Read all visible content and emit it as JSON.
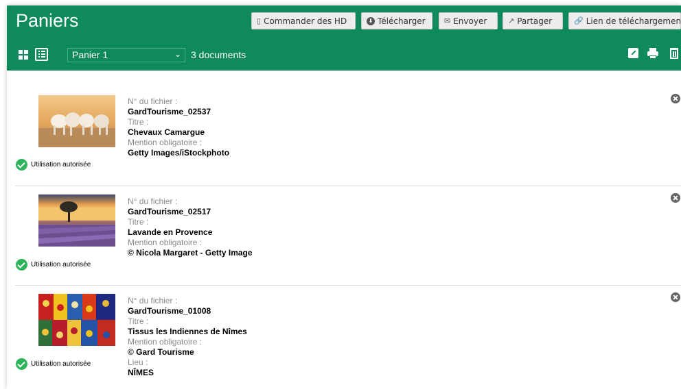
{
  "page": {
    "title": "Paniers"
  },
  "toolbar": {
    "buttons": [
      {
        "label": "Commander des HD",
        "icon": "clipboard-icon"
      },
      {
        "label": "Télécharger",
        "icon": "download-icon"
      },
      {
        "label": "Envoyer",
        "icon": "envelope-icon"
      },
      {
        "label": "Partager",
        "icon": "share-icon"
      },
      {
        "label": "Lien de téléchargement",
        "icon": "link-icon"
      }
    ]
  },
  "subbar": {
    "selected_basket": "Panier 1",
    "document_count": "3 documents"
  },
  "labels": {
    "file_number": "N° du fichier :",
    "title": "Titre :",
    "mandatory_credit": "Mention obligatoire :",
    "place": "Lieu :"
  },
  "items": [
    {
      "status": "Utilisation autorisée",
      "file_number": "GardTourisme_02537",
      "title": "Chevaux Camargue",
      "credit": "Getty Images/iStockphoto"
    },
    {
      "status": "Utilisation autorisée",
      "file_number": "GardTourisme_02517",
      "title": "Lavande en Provence",
      "credit": "© Nicola Margaret - Getty Image"
    },
    {
      "status": "Utilisation autorisée",
      "file_number": "GardTourisme_01008",
      "title": "Tissus les Indiennes de Nîmes",
      "credit": "© Gard Tourisme",
      "place": "NÎMES"
    }
  ],
  "colors": {
    "header": "#0f8a5c",
    "button_bg": "#ececec",
    "status_check": "#2db35a"
  }
}
